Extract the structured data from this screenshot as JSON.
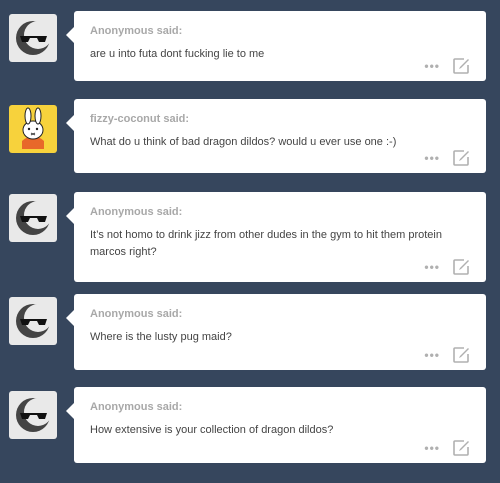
{
  "asks": [
    {
      "asker": "Anonymous said:",
      "question": "are u into futa dont fucking lie to me",
      "avatar": "anonymous-sunglasses-moon"
    },
    {
      "asker": "fizzy-coconut said:",
      "question": "What do u think of bad dragon dildos? would u ever use one :-)",
      "avatar": "miffy-bunny"
    },
    {
      "asker": "Anonymous said:",
      "question": "It’s not homo to drink jizz from other dudes in the gym to hit them protein marcos right?",
      "avatar": "anonymous-sunglasses-moon"
    },
    {
      "asker": "Anonymous said:",
      "question": "Where is the lusty pug maid?",
      "avatar": "anonymous-sunglasses-moon"
    },
    {
      "asker": "Anonymous said:",
      "question": "How extensive is your collection of dragon dildos?",
      "avatar": "anonymous-sunglasses-moon"
    }
  ],
  "icons": {
    "more": "more-dots-icon",
    "edit": "edit-icon"
  },
  "colors": {
    "background": "#36465d",
    "card": "#ffffff",
    "asker": "#a8a8a8",
    "text": "#444444"
  }
}
